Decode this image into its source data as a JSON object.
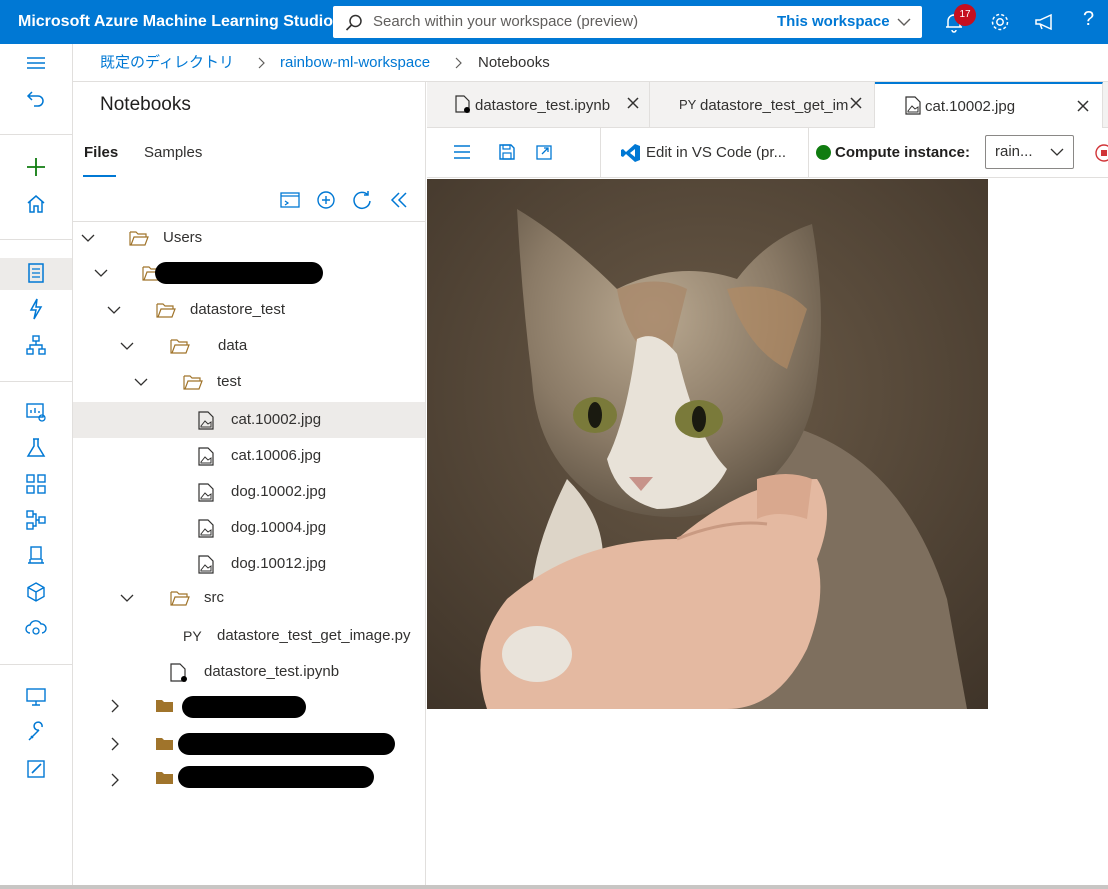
{
  "app": {
    "title": "Microsoft Azure Machine Learning Studio"
  },
  "search": {
    "placeholder": "Search within your workspace (preview)",
    "scope": "This workspace"
  },
  "topbar": {
    "notification_count": "17",
    "help": "?"
  },
  "breadcrumb": [
    "既定のディレクトリ",
    "rainbow-ml-workspace",
    "Notebooks"
  ],
  "panel": {
    "title": "Notebooks",
    "tabs": [
      "Files",
      "Samples"
    ],
    "tree": [
      {
        "label": "Users",
        "type": "folder",
        "expanded": true
      },
      {
        "label": "",
        "type": "folder",
        "expanded": true,
        "redacted": true
      },
      {
        "label": "datastore_test",
        "type": "folder",
        "expanded": true
      },
      {
        "label": "data",
        "type": "folder",
        "expanded": true
      },
      {
        "label": "test",
        "type": "folder",
        "expanded": true
      },
      {
        "label": "cat.10002.jpg",
        "type": "image",
        "selected": true
      },
      {
        "label": "cat.10006.jpg",
        "type": "image"
      },
      {
        "label": "dog.10002.jpg",
        "type": "image"
      },
      {
        "label": "dog.10004.jpg",
        "type": "image"
      },
      {
        "label": "dog.10012.jpg",
        "type": "image"
      },
      {
        "label": "src",
        "type": "folder",
        "expanded": true
      },
      {
        "label": "datastore_test_get_image.py",
        "type": "python",
        "prefix": "PY"
      },
      {
        "label": "datastore_test.ipynb",
        "type": "notebook"
      },
      {
        "label": "",
        "type": "folder",
        "expanded": false,
        "redacted": true
      },
      {
        "label": "",
        "type": "folder",
        "expanded": false,
        "redacted": true
      },
      {
        "label": "",
        "type": "folder",
        "expanded": false,
        "redacted": true
      }
    ]
  },
  "editor": {
    "tabs": [
      {
        "label": "datastore_test.ipynb",
        "type": "notebook"
      },
      {
        "label": "datastore_test_get_im",
        "type": "python",
        "prefix": "PY"
      },
      {
        "label": "cat.10002.jpg",
        "type": "image",
        "active": true
      }
    ],
    "toolbar": {
      "vscode_label": "Edit in VS Code (pr...",
      "compute_label": "Compute instance:",
      "compute_value": "rain...",
      "compute_status_color": "#107c10"
    }
  },
  "colors": {
    "brand": "#0078d4",
    "badge": "#c50f1f",
    "folder": "#a0742b"
  }
}
